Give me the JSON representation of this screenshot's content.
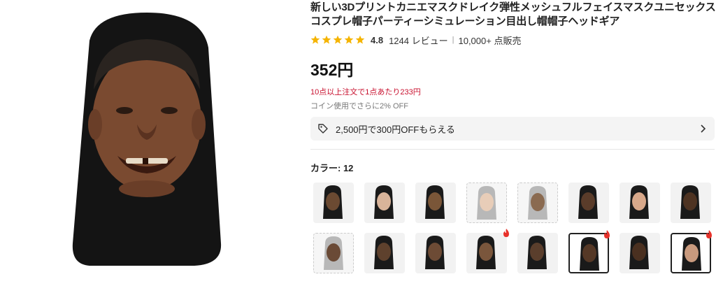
{
  "product": {
    "title": "新しい3Dプリントカニエマスクドレイク弾性メッシュフルフェイスマスクユニセックスコスプレ帽子パーティーシミュレーション目出し帽帽子ヘッドギア",
    "rating": "4.8",
    "stars": 5,
    "reviews": "1244 レビュー",
    "sold": "10,000+ 点販売",
    "price": "352円",
    "bulk_offer": "10点以上注文で1点あたり233円",
    "coin_offer": "コイン使用でさらに2% OFF",
    "coupon": "2,500円で300円OFFもらえる",
    "color_label": "カラー: 12"
  },
  "colors": {
    "accent_red": "#c8102e",
    "star": "#f5b400",
    "hot": "#e8322b"
  },
  "thumbnails": [
    {
      "name": "color-option-1",
      "skin": "#6b4a32",
      "bg": "#1a1a1a",
      "dashed": false,
      "selected": false,
      "hot": false
    },
    {
      "name": "color-option-2",
      "skin": "#d9b49a",
      "bg": "#1a1a1a",
      "dashed": false,
      "selected": false,
      "hot": false
    },
    {
      "name": "color-option-3",
      "skin": "#7a5638",
      "bg": "#1e2a6a",
      "dashed": false,
      "selected": false,
      "hot": false
    },
    {
      "name": "color-option-4",
      "skin": "#e8cdb8",
      "bg": "#e6e6e6",
      "dashed": true,
      "selected": false,
      "hot": false
    },
    {
      "name": "color-option-5",
      "skin": "#8a6a50",
      "bg": "#e6e6e6",
      "dashed": true,
      "selected": false,
      "hot": false
    },
    {
      "name": "color-option-6",
      "skin": "#5a3c2a",
      "bg": "#1a1a1a",
      "dashed": false,
      "selected": false,
      "hot": false
    },
    {
      "name": "color-option-7",
      "skin": "#d8a88a",
      "bg": "#1a1a1a",
      "dashed": false,
      "selected": false,
      "hot": false
    },
    {
      "name": "color-option-8",
      "skin": "#4e3322",
      "bg": "#1a1a1a",
      "dashed": false,
      "selected": false,
      "hot": false
    },
    {
      "name": "color-option-9",
      "skin": "#6a4a36",
      "bg": "#e6e6e6",
      "dashed": true,
      "selected": false,
      "hot": false
    },
    {
      "name": "color-option-10",
      "skin": "#5e412d",
      "bg": "#1a1a1a",
      "dashed": false,
      "selected": false,
      "hot": false
    },
    {
      "name": "color-option-11",
      "skin": "#6d4b35",
      "bg": "#1a1a1a",
      "dashed": false,
      "selected": false,
      "hot": false
    },
    {
      "name": "color-option-12",
      "skin": "#7a563c",
      "bg": "#1a1a1a",
      "dashed": false,
      "selected": false,
      "hot": true
    },
    {
      "name": "color-option-13",
      "skin": "#5a3e2c",
      "bg": "#1a1a1a",
      "dashed": false,
      "selected": false,
      "hot": false
    },
    {
      "name": "color-option-14",
      "skin": "#553826",
      "bg": "#1a1a1a",
      "dashed": false,
      "selected": true,
      "hot": true
    },
    {
      "name": "color-option-15",
      "skin": "#4a3020",
      "bg": "#1a1a1a",
      "dashed": false,
      "selected": false,
      "hot": false
    },
    {
      "name": "color-option-16",
      "skin": "#c99a7e",
      "bg": "#1a1a1a",
      "dashed": false,
      "selected": true,
      "hot": true
    }
  ]
}
